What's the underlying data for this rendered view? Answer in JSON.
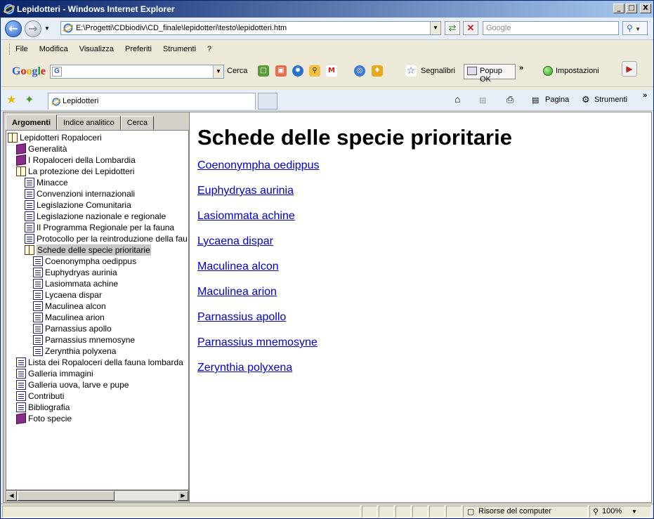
{
  "window": {
    "title": "Lepidotteri - Windows Internet Explorer",
    "minimize": "_",
    "maximize": "□",
    "close": "X"
  },
  "address": {
    "url": "E:\\Progetti\\CDbiodiv\\CD_finale\\lepidotteri\\testo\\lepidotteri.htm",
    "search_placeholder": "Google"
  },
  "menu": [
    "File",
    "Modifica",
    "Visualizza",
    "Preferiti",
    "Strumenti",
    "?"
  ],
  "google_toolbar": {
    "logo": "Google",
    "cerca": "Cerca",
    "segnalibri": "Segnalibri",
    "popup_ok": "Popup OK",
    "impostazioni": "Impostazioni"
  },
  "tab": {
    "title": "Lepidotteri"
  },
  "commandbar": {
    "pagina": "Pagina",
    "strumenti": "Strumenti"
  },
  "left_tabs": [
    "Argomenti",
    "Indice analitico",
    "Cerca"
  ],
  "tree": [
    {
      "label": "Lepidotteri Ropaloceri",
      "icon": "book-open",
      "indent": 0
    },
    {
      "label": "Generalità",
      "icon": "book-closed",
      "indent": 1
    },
    {
      "label": "I Ropaloceri della Lombardia",
      "icon": "book-closed",
      "indent": 1
    },
    {
      "label": "La protezione dei Lepidotteri",
      "icon": "book-open",
      "indent": 1
    },
    {
      "label": "Minacce",
      "icon": "page",
      "indent": 2
    },
    {
      "label": "Convenzioni internazionali",
      "icon": "page",
      "indent": 2
    },
    {
      "label": "Legislazione Comunitaria",
      "icon": "page",
      "indent": 2
    },
    {
      "label": "Legislazione nazionale e regionale",
      "icon": "page",
      "indent": 2
    },
    {
      "label": "Il Programma Regionale per la fauna",
      "icon": "page",
      "indent": 2
    },
    {
      "label": "Protocollo per la reintroduzione della fau",
      "icon": "page",
      "indent": 2
    },
    {
      "label": "Schede delle specie prioritarie",
      "icon": "book-open",
      "indent": 2,
      "selected": true
    },
    {
      "label": "Coenonympha oedippus",
      "icon": "page",
      "indent": 3
    },
    {
      "label": "Euphydryas aurinia",
      "icon": "page",
      "indent": 3
    },
    {
      "label": "Lasiommata achine",
      "icon": "page",
      "indent": 3
    },
    {
      "label": "Lycaena dispar",
      "icon": "page",
      "indent": 3
    },
    {
      "label": "Maculinea alcon",
      "icon": "page",
      "indent": 3
    },
    {
      "label": "Maculinea arion",
      "icon": "page",
      "indent": 3
    },
    {
      "label": "Parnassius apollo",
      "icon": "page",
      "indent": 3
    },
    {
      "label": "Parnassius mnemosyne",
      "icon": "page",
      "indent": 3
    },
    {
      "label": "Zerynthia polyxena",
      "icon": "page",
      "indent": 3
    },
    {
      "label": "Lista dei Ropaloceri della fauna lombarda",
      "icon": "page",
      "indent": 1
    },
    {
      "label": "Galleria immagini",
      "icon": "page",
      "indent": 1
    },
    {
      "label": "Galleria uova, larve e pupe",
      "icon": "page",
      "indent": 1
    },
    {
      "label": "Contributi",
      "icon": "page",
      "indent": 1
    },
    {
      "label": "Bibliografia",
      "icon": "page",
      "indent": 1
    },
    {
      "label": "Foto specie",
      "icon": "book-closed",
      "indent": 1
    }
  ],
  "main": {
    "heading": "Schede delle specie prioritarie",
    "links": [
      "Coenonympha oedippus",
      "Euphydryas aurinia",
      "Lasiommata achine",
      "Lycaena dispar",
      "Maculinea alcon",
      "Maculinea arion",
      "Parnassius apollo",
      "Parnassius mnemosyne",
      "Zerynthia polyxena"
    ]
  },
  "status": {
    "zone": "Risorse del computer",
    "zoom": "100%"
  }
}
